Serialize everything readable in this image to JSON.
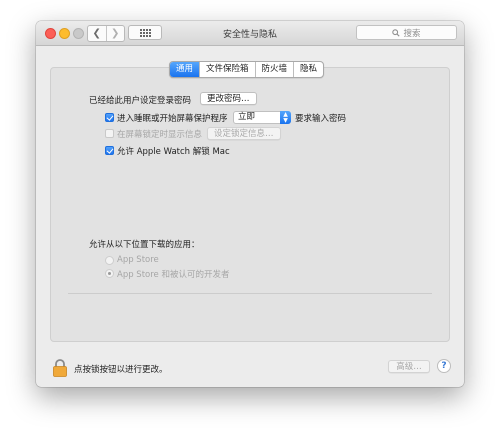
{
  "window": {
    "title": "安全性与隐私"
  },
  "toolbar": {
    "back_glyph": "❮",
    "forward_glyph": "❯",
    "grid_icon": "grid-icon",
    "search_placeholder": "搜索"
  },
  "tabs": [
    {
      "label": "通用",
      "active": true
    },
    {
      "label": "文件保险箱",
      "active": false
    },
    {
      "label": "防火墙",
      "active": false
    },
    {
      "label": "隐私",
      "active": false
    }
  ],
  "general": {
    "password_label": "已经给此用户设定登录密码",
    "change_password_button": "更改密码…",
    "require_password": {
      "label": "进入睡眠或开始屏幕保护程序",
      "checked": true,
      "delay": "立即",
      "suffix": "要求输入密码"
    },
    "lock_message": {
      "label": "在屏幕锁定时显示信息",
      "checked": false,
      "button": "设定锁定信息…"
    },
    "apple_watch": {
      "label": "允许 Apple Watch 解锁 Mac",
      "checked": true
    }
  },
  "downloads": {
    "heading": "允许从以下位置下载的应用：",
    "options": [
      {
        "label": "App Store",
        "selected": false
      },
      {
        "label": "App Store 和被认可的开发者",
        "selected": true
      }
    ]
  },
  "footer": {
    "lock_text": "点按锁按钮以进行更改。",
    "advanced_button": "高级…",
    "help_glyph": "?"
  },
  "colors": {
    "accent": "#1a73ef",
    "lock": "#f0a93a"
  }
}
